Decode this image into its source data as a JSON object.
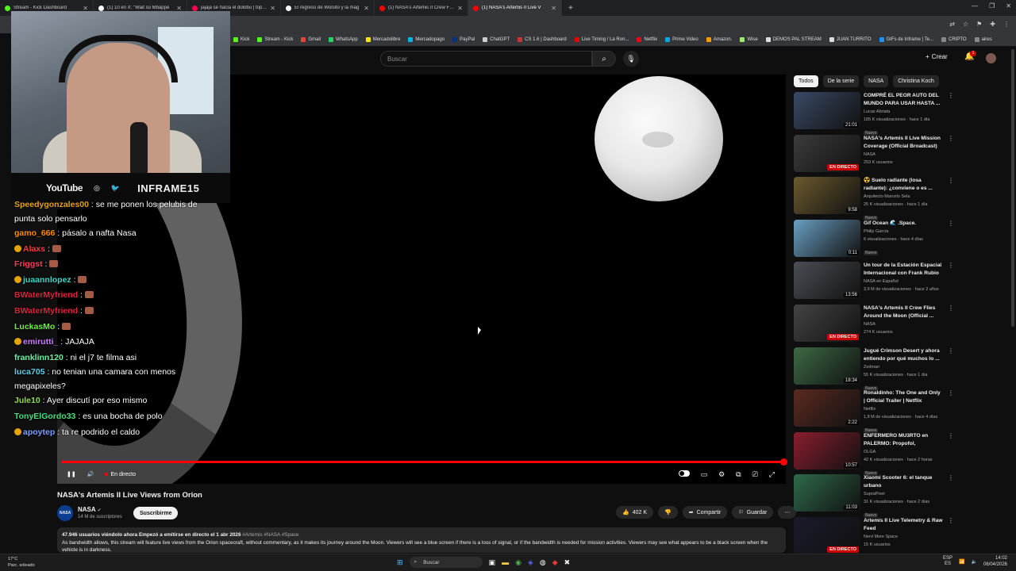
{
  "browser": {
    "tabs": [
      {
        "title": "Stream - Kick Dashboard",
        "color": "#53fc18",
        "active": false
      },
      {
        "title": "(1) 10 en X: \"Wait so Mbappé",
        "color": "#ffffff",
        "active": false
      },
      {
        "title": "jajaja se hacia el dolobu | top og",
        "color": "#ff0050",
        "active": false
      },
      {
        "title": "El regreso de Wolsito y la mag",
        "color": "#ffffff",
        "active": false
      },
      {
        "title": "(1) NASA's Artemis II Crew Flies",
        "color": "#ff0000",
        "active": false
      },
      {
        "title": "(1) NASA's Artemis II Live V",
        "color": "#ff0000",
        "active": true
      }
    ],
    "bookmarks": [
      {
        "label": "Kick",
        "color": "#53fc18"
      },
      {
        "label": "Stream - Kick",
        "color": "#53fc18"
      },
      {
        "label": "Gmail",
        "color": "#ea4335"
      },
      {
        "label": "WhatsApp",
        "color": "#25d366"
      },
      {
        "label": "Mercadolibre",
        "color": "#ffe600"
      },
      {
        "label": "Mercadopago",
        "color": "#00b1ea"
      },
      {
        "label": "PayPal",
        "color": "#003087"
      },
      {
        "label": "ChatGPT",
        "color": "#cccccc"
      },
      {
        "label": "CS 1.6 | Dashboard",
        "color": "#cc3333"
      },
      {
        "label": "Live Timing / La Ron...",
        "color": "#e10600"
      },
      {
        "label": "Netflix",
        "color": "#e50914"
      },
      {
        "label": "Prime Video",
        "color": "#00a8e1"
      },
      {
        "label": "Amazon.",
        "color": "#ff9900"
      },
      {
        "label": "Wise",
        "color": "#9fe870"
      },
      {
        "label": "DEMOS PAL STREAM",
        "color": "#dddddd"
      },
      {
        "label": "JUAN TURRITO",
        "color": "#dddddd"
      },
      {
        "label": "GIFs de Inframe | Te...",
        "color": "#1e90ff"
      },
      {
        "label": "CRIPTO",
        "color": "#888888"
      },
      {
        "label": "aires",
        "color": "#888888"
      }
    ]
  },
  "stream_overlay": {
    "platform": "YouTube",
    "handle": "INFRAME15",
    "chat": [
      {
        "user": "Speedygonzales00",
        "color": "#e6a11a",
        "badge": false,
        "text": "se me ponen los pelubis de punta solo pensarlo",
        "wrap": true
      },
      {
        "user": "gamo_666",
        "color": "#ff8c00",
        "badge": false,
        "text": "pásalo a nafta Nasa",
        "wrap": false
      },
      {
        "user": "Alaxs",
        "color": "#ff3b3b",
        "badge": true,
        "text": "",
        "emote": true,
        "wrap": false
      },
      {
        "user": "Friggst",
        "color": "#ff3b5c",
        "badge": false,
        "text": "",
        "emote": true,
        "wrap": false
      },
      {
        "user": "juaannlopez",
        "color": "#3ad7c7",
        "badge": true,
        "text": "",
        "emote": true,
        "wrap": false
      },
      {
        "user": "BWaterMyfriend",
        "color": "#e0203c",
        "badge": false,
        "text": "",
        "emote": true,
        "wrap": false
      },
      {
        "user": "BWaterMyfriend",
        "color": "#e0203c",
        "badge": false,
        "text": "",
        "emote": true,
        "wrap": false
      },
      {
        "user": "LuckasMo",
        "color": "#6cf03c",
        "badge": false,
        "text": "",
        "emote": true,
        "wrap": false
      },
      {
        "user": "emirutti_",
        "color": "#c77dff",
        "badge": true,
        "text": "JAJAJA",
        "wrap": false
      },
      {
        "user": "franklinn120",
        "color": "#6cf0a0",
        "badge": false,
        "text": "ni el j7 te filma asi",
        "wrap": false
      },
      {
        "user": "luca705",
        "color": "#5ad1e6",
        "badge": false,
        "text": "no tenian una camara con menos megapixeles?",
        "wrap": true
      },
      {
        "user": "Jule10",
        "color": "#8de04a",
        "badge": false,
        "text": "Ayer discutí por eso mismo",
        "wrap": false
      },
      {
        "user": "TonyElGordo33",
        "color": "#4ade80",
        "badge": false,
        "text": "es una bocha de polo",
        "wrap": false
      },
      {
        "user": "apoytep",
        "color": "#7aa0ff",
        "badge": true,
        "text": "ta re podrido el caldo",
        "wrap": false
      }
    ]
  },
  "youtube": {
    "search_placeholder": "Buscar",
    "create_label": "Crear",
    "notif_count": "1",
    "player": {
      "live_label": "En directo",
      "progress": 1.0
    },
    "video": {
      "title": "NASA's Artemis II Live Views from Orion",
      "channel": "NASA",
      "channel_logo": "NASA",
      "subscribers": "14 M de suscriptores",
      "subscribe_label": "Suscribirme",
      "likes": "402 K",
      "share_label": "Compartir",
      "save_label": "Guardar",
      "stats": "47.946 usuarios viéndolo ahora  Empezó a emitirse en directo el 1 abr 2026",
      "tags": "#Artemis #NASA #Space",
      "description": "As bandwidth allows, this stream will feature live views from the Orion spacecraft, without commentary, as it makes its journey around the Moon. Viewers will see a blue screen if there is a loss of signal, or if the bandwidth is needed for mission activities. Viewers may see what appears to be a black screen when the vehicle is in darkness."
    },
    "chips": [
      "Todos",
      "De la serie",
      "NASA",
      "Christina Koch"
    ],
    "recommendations": [
      {
        "title": "COMPRÉ EL PEOR AUTO DEL MUNDO PARA USAR HASTA ...",
        "channel": "Lucas Abriata",
        "meta": "185 K visualizaciones · hace 1 día",
        "badge": "21:01",
        "live": false,
        "new": true,
        "thumb": "#3a4a66"
      },
      {
        "title": "NASA's Artemis II Live Mission Coverage (Official Broadcast)",
        "channel": "NASA",
        "meta": "253 K usuarios",
        "badge": "EN DIRECTO",
        "live": true,
        "new": false,
        "thumb": "#3c3c3c"
      },
      {
        "title": "☢️ Suelo radiante (losa radiante): ¿conviene o es ...",
        "channel": "Arquitecto Marcelo Sela",
        "meta": "25 K visualizaciones · hace 1 día",
        "badge": "9:58",
        "live": false,
        "new": true,
        "thumb": "#6b5a2e"
      },
      {
        "title": "Gif Ocean 🌊 .Space.",
        "channel": "Philip García",
        "meta": "6 visualizaciones · hace 4 días",
        "badge": "0:11",
        "live": false,
        "new": true,
        "thumb": "#6a9fc2"
      },
      {
        "title": "Un tour de la Estación Espacial Internacional con Frank Rubio",
        "channel": "NASA en Español",
        "meta": "3,9 M de visualizaciones · hace 2 años",
        "badge": "13:56",
        "live": false,
        "new": false,
        "thumb": "#4a4f55"
      },
      {
        "title": "NASA's Artemis II Crew Flies Around the Moon (Official ...",
        "channel": "NASA",
        "meta": "274 K usuarios",
        "badge": "EN DIRECTO",
        "live": true,
        "new": false,
        "thumb": "#444444"
      },
      {
        "title": "Jugué Crimson Desert y ahora entiendo por qué muchos lo ...",
        "channel": "Zedman",
        "meta": "55 K visualizaciones · hace 1 día",
        "badge": "18:34",
        "live": false,
        "new": true,
        "thumb": "#3d6a45"
      },
      {
        "title": "Ronaldinho: The One and Only | Official Trailer | Netflix",
        "channel": "Netflix",
        "meta": "1,8 M de visualizaciones · hace 4 días",
        "badge": "2:22",
        "live": false,
        "new": true,
        "thumb": "#5a2a20"
      },
      {
        "title": "ENFERMERO MU3RTO en PALERMO: Propofol, Fentanilo...",
        "channel": "OLGA",
        "meta": "42 K visualizaciones · hace 2 horas",
        "badge": "10:57",
        "live": false,
        "new": true,
        "thumb": "#8a1e2e"
      },
      {
        "title": "Xiaomi Scooter 6: el tanque urbano",
        "channel": "SupraPixel",
        "meta": "31 K visualizaciones · hace 2 días",
        "badge": "11:03",
        "live": false,
        "new": true,
        "thumb": "#2f6a4a"
      },
      {
        "title": "Artemis II Live Telemetry & Raw Feed",
        "channel": "Nerd More Space",
        "meta": "15 K usuarios",
        "badge": "EN DIRECTO",
        "live": true,
        "new": false,
        "thumb": "#1a1a2a"
      }
    ]
  },
  "taskbar": {
    "weather_temp": "17°C",
    "weather_desc": "Parc. soleado",
    "search_label": "Buscar",
    "lang": "ESP",
    "lang_sub": "ES",
    "time": "14:02",
    "date": "06/04/2026"
  }
}
